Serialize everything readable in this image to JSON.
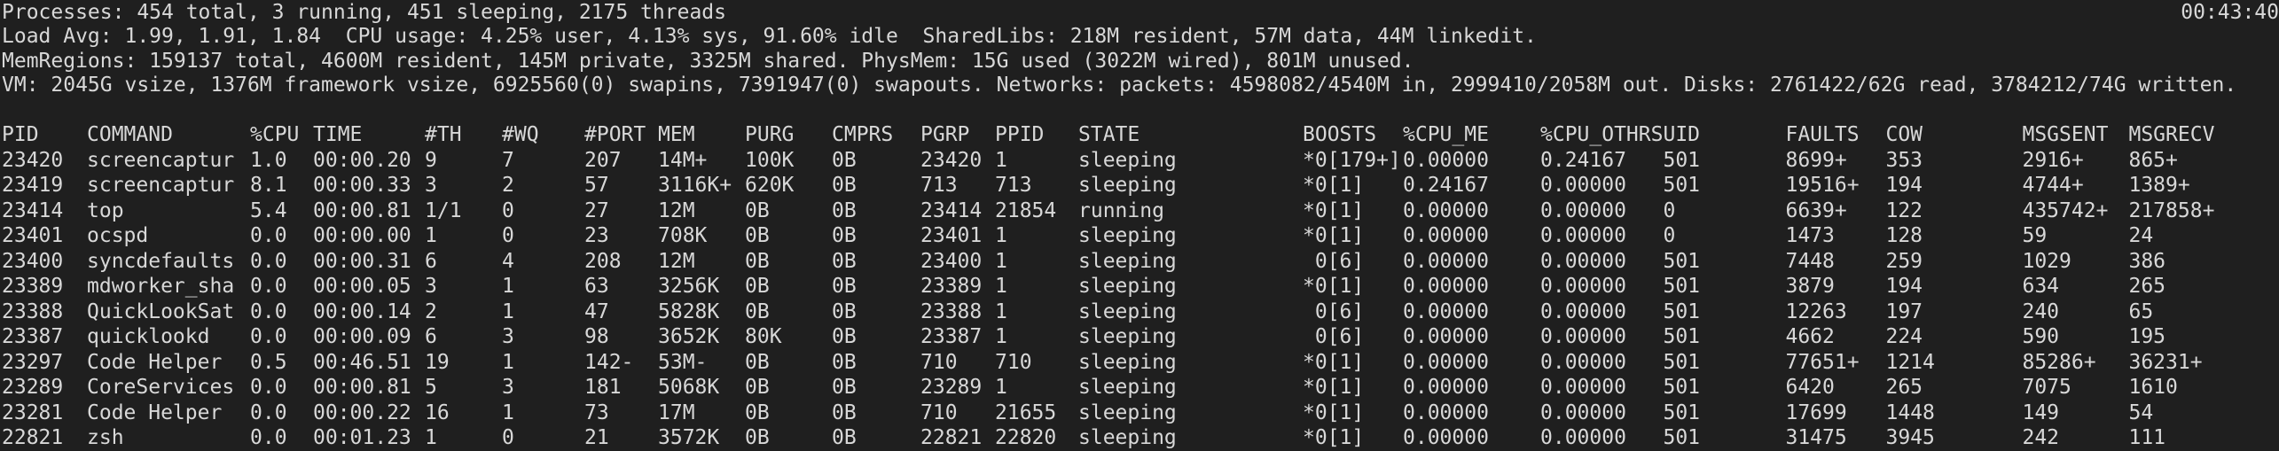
{
  "header": {
    "processes": "Processes: 454 total, 3 running, 451 sleeping, 2175 threads",
    "clock": "00:43:40",
    "load": "Load Avg: 1.99, 1.91, 1.84  CPU usage: 4.25% user, 4.13% sys, 91.60% idle  SharedLibs: 218M resident, 57M data, 44M linkedit.",
    "memregions": "MemRegions: 159137 total, 4600M resident, 145M private, 3325M shared. PhysMem: 15G used (3022M wired), 801M unused.",
    "vm": "VM: 2045G vsize, 1376M framework vsize, 6925560(0) swapins, 7391947(0) swapouts. Networks: packets: 4598082/4540M in, 2999410/2058M out. Disks: 2761422/62G read, 3784212/74G written."
  },
  "table": {
    "columns": [
      "PID",
      "COMMAND",
      "%CPU",
      "TIME",
      "#TH",
      "#WQ",
      "#PORT",
      "MEM",
      "PURG",
      "CMPRS",
      "PGRP",
      "PPID",
      "STATE",
      "BOOSTS",
      "%CPU_ME",
      "%CPU_OTHRS",
      "UID",
      "FAULTS",
      "COW",
      "MSGSENT",
      "MSGRECV"
    ],
    "rows": [
      [
        "23420",
        "screencaptur",
        "1.0",
        "00:00.20",
        "9",
        "7",
        "207",
        "14M+",
        "100K",
        "0B",
        "23420",
        "1",
        "sleeping",
        "*0[179+]",
        "0.00000",
        "0.24167",
        "501",
        "8699+",
        "353",
        "2916+",
        "865+"
      ],
      [
        "23419",
        "screencaptur",
        "8.1",
        "00:00.33",
        "3",
        "2",
        "57",
        "3116K+",
        "620K",
        "0B",
        "713",
        "713",
        "sleeping",
        "*0[1]",
        "0.24167",
        "0.00000",
        "501",
        "19516+",
        "194",
        "4744+",
        "1389+"
      ],
      [
        "23414",
        "top",
        "5.4",
        "00:00.81",
        "1/1",
        "0",
        "27",
        "12M",
        "0B",
        "0B",
        "23414",
        "21854",
        "running",
        "*0[1]",
        "0.00000",
        "0.00000",
        "0",
        "6639+",
        "122",
        "435742+",
        "217858+"
      ],
      [
        "23401",
        "ocspd",
        "0.0",
        "00:00.00",
        "1",
        "0",
        "23",
        "708K",
        "0B",
        "0B",
        "23401",
        "1",
        "sleeping",
        "*0[1]",
        "0.00000",
        "0.00000",
        "0",
        "1473",
        "128",
        "59",
        "24"
      ],
      [
        "23400",
        "syncdefaults",
        "0.0",
        "00:00.31",
        "6",
        "4",
        "208",
        "12M",
        "0B",
        "0B",
        "23400",
        "1",
        "sleeping",
        " 0[6]",
        "0.00000",
        "0.00000",
        "501",
        "7448",
        "259",
        "1029",
        "386"
      ],
      [
        "23389",
        "mdworker_sha",
        "0.0",
        "00:00.05",
        "3",
        "1",
        "63",
        "3256K",
        "0B",
        "0B",
        "23389",
        "1",
        "sleeping",
        "*0[1]",
        "0.00000",
        "0.00000",
        "501",
        "3879",
        "194",
        "634",
        "265"
      ],
      [
        "23388",
        "QuickLookSat",
        "0.0",
        "00:00.14",
        "2",
        "1",
        "47",
        "5828K",
        "0B",
        "0B",
        "23388",
        "1",
        "sleeping",
        " 0[6]",
        "0.00000",
        "0.00000",
        "501",
        "12263",
        "197",
        "240",
        "65"
      ],
      [
        "23387",
        "quicklookd",
        "0.0",
        "00:00.09",
        "6",
        "3",
        "98",
        "3652K",
        "80K",
        "0B",
        "23387",
        "1",
        "sleeping",
        " 0[6]",
        "0.00000",
        "0.00000",
        "501",
        "4662",
        "224",
        "590",
        "195"
      ],
      [
        "23297",
        "Code Helper",
        "0.5",
        "00:46.51",
        "19",
        "1",
        "142-",
        "53M-",
        "0B",
        "0B",
        "710",
        "710",
        "sleeping",
        "*0[1]",
        "0.00000",
        "0.00000",
        "501",
        "77651+",
        "1214",
        "85286+",
        "36231+"
      ],
      [
        "23289",
        "CoreServices",
        "0.0",
        "00:00.81",
        "5",
        "3",
        "181",
        "5068K",
        "0B",
        "0B",
        "23289",
        "1",
        "sleeping",
        "*0[1]",
        "0.00000",
        "0.00000",
        "501",
        "6420",
        "265",
        "7075",
        "1610"
      ],
      [
        "23281",
        "Code Helper",
        "0.0",
        "00:00.22",
        "16",
        "1",
        "73",
        "17M",
        "0B",
        "0B",
        "710",
        "21655",
        "sleeping",
        "*0[1]",
        "0.00000",
        "0.00000",
        "501",
        "17699",
        "1448",
        "149",
        "54"
      ],
      [
        "22821",
        "zsh",
        "0.0",
        "00:01.23",
        "1",
        "0",
        "21",
        "3572K",
        "0B",
        "0B",
        "22821",
        "22820",
        "sleeping",
        "*0[1]",
        "0.00000",
        "0.00000",
        "501",
        "31475",
        "3945",
        "242",
        "111"
      ]
    ]
  }
}
